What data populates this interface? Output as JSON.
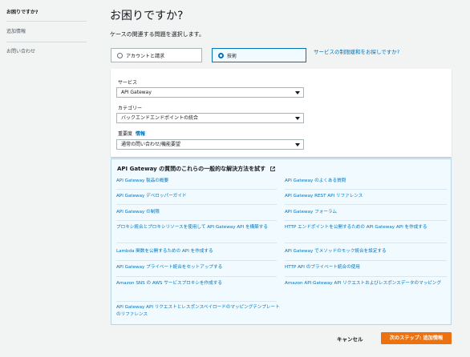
{
  "sidebar": {
    "items": [
      {
        "label": "お困りですか?",
        "active": true
      },
      {
        "label": "追加情報",
        "active": false
      },
      {
        "label": "お問い合わせ",
        "active": false
      }
    ]
  },
  "page": {
    "title": "お困りですか?",
    "subtitle": "ケースの関連する問題を選択します。"
  },
  "category": {
    "options": [
      {
        "label": "アカウントと請求",
        "selected": false
      },
      {
        "label": "技術",
        "selected": true
      }
    ],
    "limit_link": "サービスの制限緩和をお探しですか?"
  },
  "form": {
    "service": {
      "label": "サービス",
      "value": "API Gateway"
    },
    "category": {
      "label": "カテゴリー",
      "value": "バックエンドエンドポイントの統合"
    },
    "severity": {
      "label": "重要度",
      "info": "情報",
      "value": "通常の問い合わせ/機能要望"
    }
  },
  "solutions": {
    "heading": "API Gateway の質問のこれらの一般的な解決方法を試す",
    "left": [
      "API Gateway 製品の概要",
      "API Gateway デベロッパーガイド",
      "API Gateway の制限",
      "プロキシ統合とプロキシリソースを使用して API Gateway API を構築する",
      "Lambda 関数を公開するための API を作成する",
      "API Gateway プライベート統合をセットアップする",
      "Amazon SNS の AWS サービスプロキシを作成する",
      "API Gateway API リクエストとレスポンスペイロードのマッピングテンプレートのリファレンス"
    ],
    "right": [
      "API Gateway のよくある質問",
      "API Gateway REST API リファレンス",
      "API Gateway フォーラム",
      "HTTP エンドポイントを公開するための API Gateway API を作成する",
      "API Gateway でメソッドのモック統合を設定する",
      "HTTP API のプライベート統合の使用",
      "Amazon API Gateway API リクエストおよびレスポンスデータのマッピング"
    ]
  },
  "footer": {
    "cancel": "キャンセル",
    "next": "次のステップ: 追加情報"
  }
}
